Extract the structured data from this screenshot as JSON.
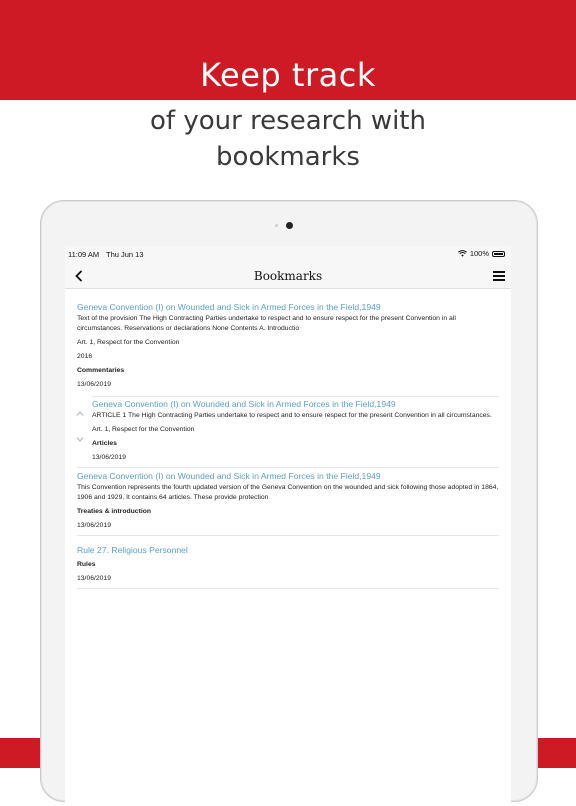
{
  "colors": {
    "brand": "#ce1a25",
    "link": "#5c9fc7"
  },
  "promo": {
    "headline": "Keep track",
    "sub_line1": "of your research with",
    "sub_line2": "bookmarks"
  },
  "status_bar": {
    "time": "11:09 AM",
    "date": "Thu Jun 13",
    "battery": "100%"
  },
  "nav": {
    "title": "Bookmarks",
    "back_icon": "chevron-left-icon",
    "menu_icon": "hamburger-menu-icon"
  },
  "bookmarks": [
    {
      "title": "Geneva Convention (I) on Wounded and Sick in Armed Forces in the Field,1949",
      "text": "Text of the provision The High Contracting Parties undertake to respect and to ensure respect for the present Convention in all circumstances. Reservations or declarations None Contents A. Introductio",
      "article": "Art. 1, Respect for the Convention",
      "year": "2016",
      "category": "Commentaries",
      "date": "13/06/2019",
      "nested": {
        "title": "Geneva Convention (I) on Wounded and Sick in Armed Forces in the Field,1949",
        "text": "ARTICLE 1 The High Contracting Parties undertake to respect and to ensure respect for the present Convention in all circumstances.",
        "article": "Art. 1, Respect for the Convention",
        "category": "Articles",
        "date": "13/06/2019"
      }
    },
    {
      "title": "Geneva Convention (I) on Wounded and Sick in Armed Forces in the Field,1949",
      "text": "This Convention represents the fourth updated version of the Geneva Convention on the wounded and sick following those adopted in 1864, 1906 and 1929. It contains 64 articles. These provide protection",
      "category": "Treaties & introduction",
      "date": "13/06/2019"
    },
    {
      "title": "Rule 27. Religious Personnel",
      "category": "Rules",
      "date": "13/06/2019"
    }
  ]
}
